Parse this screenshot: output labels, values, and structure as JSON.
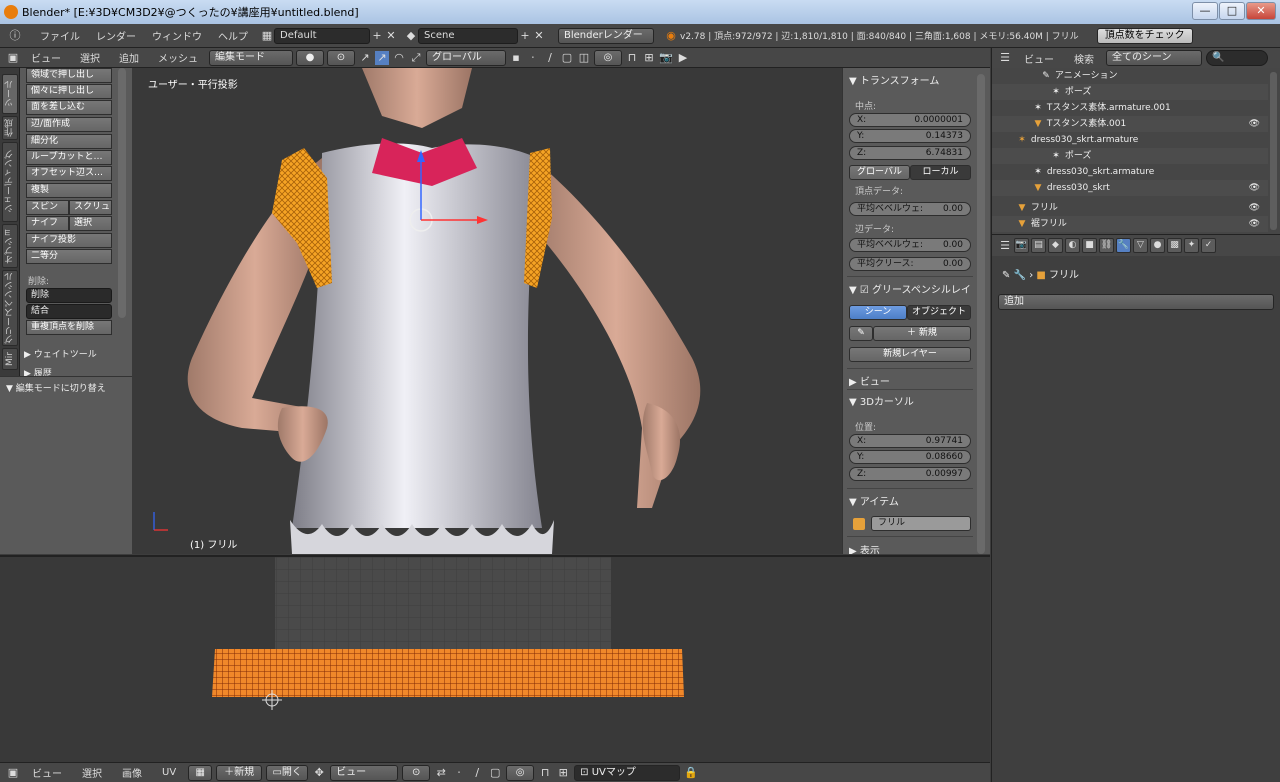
{
  "window": {
    "title": "Blender* [E:¥3D¥CM3D2¥@つくったの¥講座用¥untitled.blend]",
    "min": "—",
    "max": "□",
    "close": "✕"
  },
  "info": {
    "menus": [
      "ファイル",
      "レンダー",
      "ウィンドウ",
      "ヘルプ"
    ],
    "layout": "Default",
    "scene": "Scene",
    "engine": "Blenderレンダー",
    "stats": "v2.78 | 頂点:972/972 | 辺:1,810/1,810 | 面:840/840 | 三角面:1,608 | メモリ:56.40M | フリル",
    "check_button": "頂点数をチェック"
  },
  "view3d_header": {
    "menus": [
      "ビュー",
      "選択",
      "追加",
      "メッシュ"
    ],
    "mode": "編集モード",
    "orientation": "グローバル"
  },
  "tool_tabs": [
    "ツール",
    "作成",
    "シェーディング",
    "オプション",
    "グリースペンシル",
    "Mir"
  ],
  "tool_shelf": {
    "buttons": [
      "領域で押し出し",
      "個々に押し出し",
      "面を差し込む",
      "辺/面作成",
      "細分化",
      "ループカットと…",
      "オフセット辺ス…",
      "複製"
    ],
    "pairs": [
      [
        "スピン",
        "スクリュ"
      ],
      [
        "ナイフ",
        "選択"
      ]
    ],
    "buttons2": [
      "ナイフ投影",
      "二等分"
    ],
    "delete_label": "削除:",
    "dropdowns": [
      "削除",
      "結合"
    ],
    "remove_doubles": "重複頂点を削除",
    "panel_weight": "ウェイトツール",
    "panel_history": "履歴",
    "operator": "編集モードに切り替え"
  },
  "viewport": {
    "view_label": "ユーザー・平行投影",
    "object_label": "(1) フリル"
  },
  "npanel": {
    "transform": "トランスフォーム",
    "median": "中点:",
    "x": {
      "label": "X:",
      "value": "0.0000001"
    },
    "y": {
      "label": "Y:",
      "value": "0.14373"
    },
    "z": {
      "label": "Z:",
      "value": "6.74831"
    },
    "global": "グローバル",
    "local": "ローカル",
    "vertex_data": "頂点データ:",
    "bevel_weight_v": {
      "label": "平均ベベルウェ:",
      "value": "0.00"
    },
    "edge_data": "辺データ:",
    "bevel_weight_e": {
      "label": "平均ベベルウェ:",
      "value": "0.00"
    },
    "crease": {
      "label": "平均クリース:",
      "value": "0.00"
    },
    "grease_pencil": "グリースペンシルレイ",
    "scene_btn": "シーン",
    "object_btn": "オブジェクト",
    "new_btn": "新規",
    "new_layer": "新規レイヤー",
    "view": "ビュー",
    "cursor": "3Dカーソル",
    "location": "位置:",
    "cx": {
      "label": "X:",
      "value": "0.97741"
    },
    "cy": {
      "label": "Y:",
      "value": "0.08660"
    },
    "cz": {
      "label": "Z:",
      "value": "0.00997"
    },
    "item": "アイテム",
    "item_name": "フリル",
    "display": "表示"
  },
  "uv_header": {
    "menus": [
      "ビュー",
      "選択",
      "画像",
      "UV"
    ],
    "new": "新規",
    "open": "開く",
    "view": "ビュー",
    "uvmap": "UVマップ"
  },
  "outliner_header": {
    "menus": [
      "ビュー",
      "検索"
    ],
    "filter": "全てのシーン"
  },
  "outliner": [
    {
      "name": "アニメーション",
      "indent": 3,
      "icon": "action-icon"
    },
    {
      "name": "ポーズ",
      "indent": 3,
      "icon": "pose-icon"
    },
    {
      "name": "Tスタンス素体.armature.001",
      "indent": 2,
      "icon": "armature-icon"
    },
    {
      "name": "Tスタンス素体.001",
      "indent": 2,
      "icon": "mesh-icon"
    },
    {
      "name": "dress030_skrt.armature",
      "indent": 1,
      "icon": "armature-icon"
    },
    {
      "name": "ポーズ",
      "indent": 3,
      "icon": "pose-icon"
    },
    {
      "name": "dress030_skrt.armature",
      "indent": 2,
      "icon": "armature-icon"
    },
    {
      "name": "dress030_skrt",
      "indent": 2,
      "icon": "mesh-icon"
    },
    {
      "name": "フリル",
      "indent": 1,
      "icon": "mesh-icon"
    },
    {
      "name": "裾フリル",
      "indent": 1,
      "icon": "mesh-icon"
    }
  ],
  "properties": {
    "object_name": "フリル",
    "add_modifier": "追加"
  }
}
